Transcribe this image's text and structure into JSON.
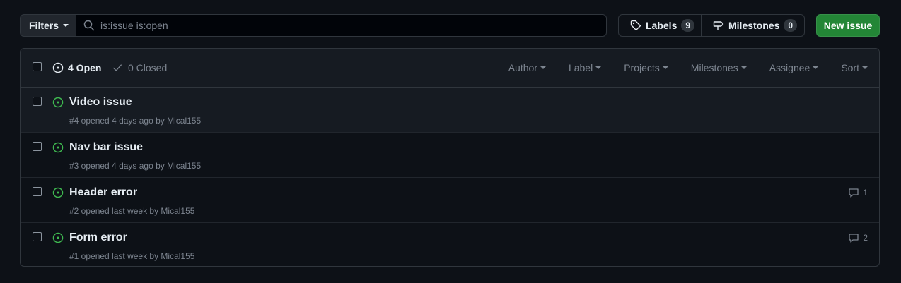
{
  "toolbar": {
    "filters_label": "Filters",
    "search_value": "is:issue is:open",
    "labels_label": "Labels",
    "labels_count": "9",
    "milestones_label": "Milestones",
    "milestones_count": "0",
    "new_issue_label": "New issue"
  },
  "header": {
    "open_label": "4 Open",
    "closed_label": "0 Closed",
    "menus": [
      "Author",
      "Label",
      "Projects",
      "Milestones",
      "Assignee",
      "Sort"
    ]
  },
  "issues": [
    {
      "title": "Video issue",
      "meta": "#4 opened 4 days ago by Mical155",
      "comments": ""
    },
    {
      "title": "Nav bar issue",
      "meta": "#3 opened 4 days ago by Mical155",
      "comments": ""
    },
    {
      "title": "Header error",
      "meta": "#2 opened last week by Mical155",
      "comments": "1"
    },
    {
      "title": "Form error",
      "meta": "#1 opened last week by Mical155",
      "comments": "2"
    }
  ],
  "colors": {
    "background": "#0d1117",
    "accent_green": "#238636",
    "open_icon": "#3fb950",
    "muted_text": "#7d8590"
  },
  "icons": [
    "search-icon",
    "tag-icon",
    "milestone-icon",
    "issue-open-icon",
    "check-icon",
    "comment-icon"
  ]
}
